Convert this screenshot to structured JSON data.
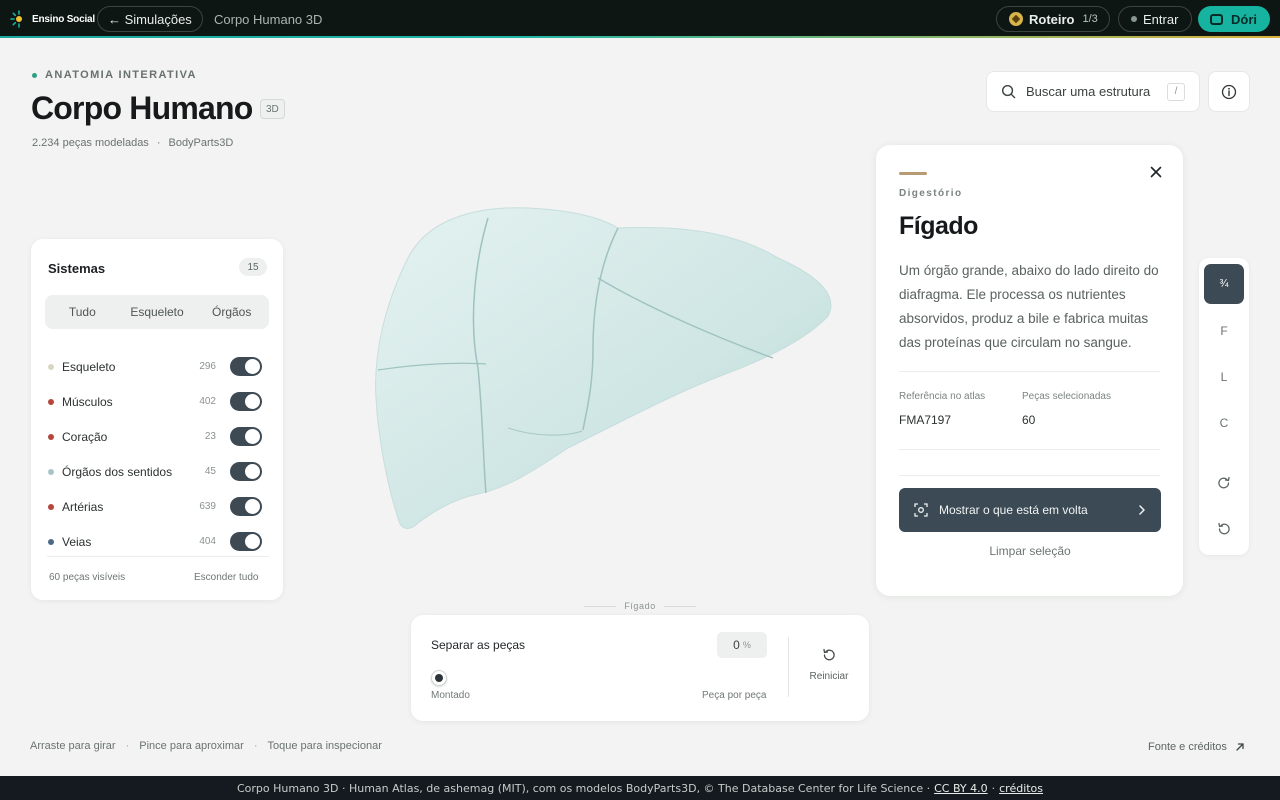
{
  "topbar": {
    "brand": "Ensino Social",
    "back_label": "← Simulações",
    "breadcrumb": "Corpo Humano 3D",
    "roteiro_label": "Roteiro",
    "roteiro_step": "1/3",
    "login_label": "Entrar",
    "assistant_label": "Dóri"
  },
  "header": {
    "kicker": "ANATOMIA INTERATIVA",
    "title": "Corpo Humano",
    "badge": "3D",
    "pieces": "2.234 peças modeladas",
    "source": "BodyParts3D"
  },
  "search": {
    "placeholder": "Buscar uma estrutura",
    "shortcut": "/"
  },
  "systems": {
    "title": "Sistemas",
    "count": "15",
    "filters": [
      "Tudo",
      "Esqueleto",
      "Órgãos"
    ],
    "items": [
      {
        "name": "Esqueleto",
        "count": "296",
        "color": "#d9d6c2",
        "on": true
      },
      {
        "name": "Músculos",
        "count": "402",
        "color": "#b6453c",
        "on": true
      },
      {
        "name": "Coração",
        "count": "23",
        "color": "#b6453c",
        "on": true
      },
      {
        "name": "Órgãos dos sentidos",
        "count": "45",
        "color": "#a9c4c4",
        "on": true
      },
      {
        "name": "Artérias",
        "count": "639",
        "color": "#b6453c",
        "on": true
      },
      {
        "name": "Veias",
        "count": "404",
        "color": "#4c6a85",
        "on": true
      }
    ],
    "visible": "60 peças visíveis",
    "hide_all": "Esconder tudo"
  },
  "viewer": {
    "organ_label": "Fígado",
    "organ_color": "#cfe6e4"
  },
  "explode": {
    "label": "Separar as peças",
    "value": "0",
    "unit": "%",
    "min_label": "Montado",
    "max_label": "Peça por peça",
    "reset_label": "Reiniciar"
  },
  "detail": {
    "category": "Digestório",
    "name": "Fígado",
    "description": "Um órgão grande, abaixo do lado direito do diafragma. Ele processa os nutrientes absorvidos, produz a bile e fabrica muitas das proteínas que circulam no sangue.",
    "ref_label": "Referência no atlas",
    "ref_value": "FMA7197",
    "selected_label": "Peças selecionadas",
    "selected_value": "60",
    "show_around": "Mostrar o que está em volta",
    "clear": "Limpar seleção",
    "accent_color": "#b89a73"
  },
  "views": {
    "three_quarter": "¾",
    "front": "F",
    "lateral": "L",
    "cranial": "C"
  },
  "hints": [
    "Arraste para girar",
    "Pince para aproximar",
    "Toque para inspecionar"
  ],
  "credits_link": "Fonte e créditos",
  "footer": {
    "text": "Corpo Humano 3D · Human Atlas, de ashemag (MIT), com os modelos BodyParts3D, © The Database Center for Life Science ·",
    "license": "CC BY 4.0",
    "middot": "·",
    "credits": "créditos"
  }
}
